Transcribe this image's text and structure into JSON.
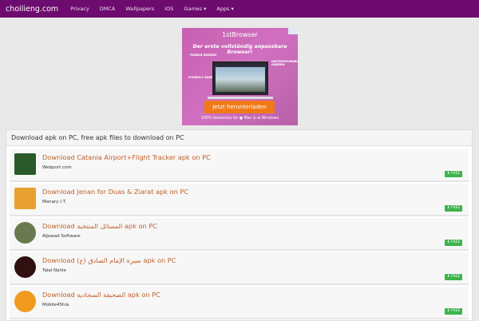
{
  "nav": {
    "brand": "choilieng.com",
    "items": [
      "Privacy",
      "DMCA",
      "Wallpapers",
      "iOS",
      "Games ▾",
      "Apps ▾"
    ]
  },
  "ad": {
    "logo": "1stBrowser",
    "tagline": "Der erste vollständig anpassbare Browser!",
    "labels": [
      "FARBEN ÄNDERN",
      "SYMBOLE ÄNDERN",
      "HINTERGRUNDBILDER ÄNDERN"
    ],
    "cta": "Jetzt herunterladen",
    "footer": "100% Kostenlos für ● Mac & ⊞ Windows"
  },
  "panel": {
    "title": "Download apk on PC, free apk files to download on PC"
  },
  "free_label": "FREE",
  "apps": [
    {
      "title": "Download Catania Airport+Flight Tracker apk on PC",
      "dev": "Webport.com",
      "color": "#2a5a2a"
    },
    {
      "title": "Download Jenan for Duas & Ziarat apk on PC",
      "dev": "Manary I.T.",
      "color": "#e8a030"
    },
    {
      "title": "Download المسائل المنتخبة apk on PC",
      "dev": "AlJawad Software",
      "color": "#6a7a50"
    },
    {
      "title": "Download (ع) سيرة الإمام الصادق apk on PC",
      "dev": "Talal Nahle",
      "color": "#301010"
    },
    {
      "title": "Download الصحيفة السجادية apk on PC",
      "dev": "Mobile4Shia",
      "color": "#f09a20"
    }
  ]
}
